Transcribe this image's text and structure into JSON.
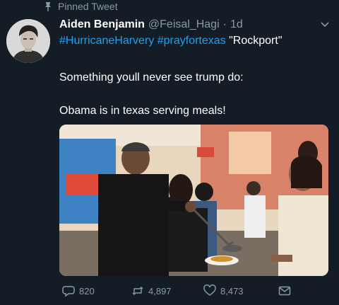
{
  "pinned": {
    "label": "Pinned Tweet"
  },
  "author": {
    "name": "Aiden Benjamin",
    "handle": "@Feisal_Hagi",
    "separator": "·",
    "time": "1d"
  },
  "tweet": {
    "hashtags": [
      "#HurricaneHarvery",
      "#prayfortexas"
    ],
    "quote": "\"Rockport\"",
    "line1": "Something youll never see trump do:",
    "line2": "Obama is in texas serving meals!"
  },
  "actions": {
    "replies": "820",
    "retweets": "4,897",
    "likes": "8,473"
  },
  "colors": {
    "background": "#141d26",
    "link": "#1da1f2",
    "muted": "#8899a6",
    "text": "#ffffff"
  },
  "icons": [
    "pin-icon",
    "chevron-down-icon",
    "reply-icon",
    "retweet-icon",
    "like-icon",
    "direct-message-icon"
  ]
}
